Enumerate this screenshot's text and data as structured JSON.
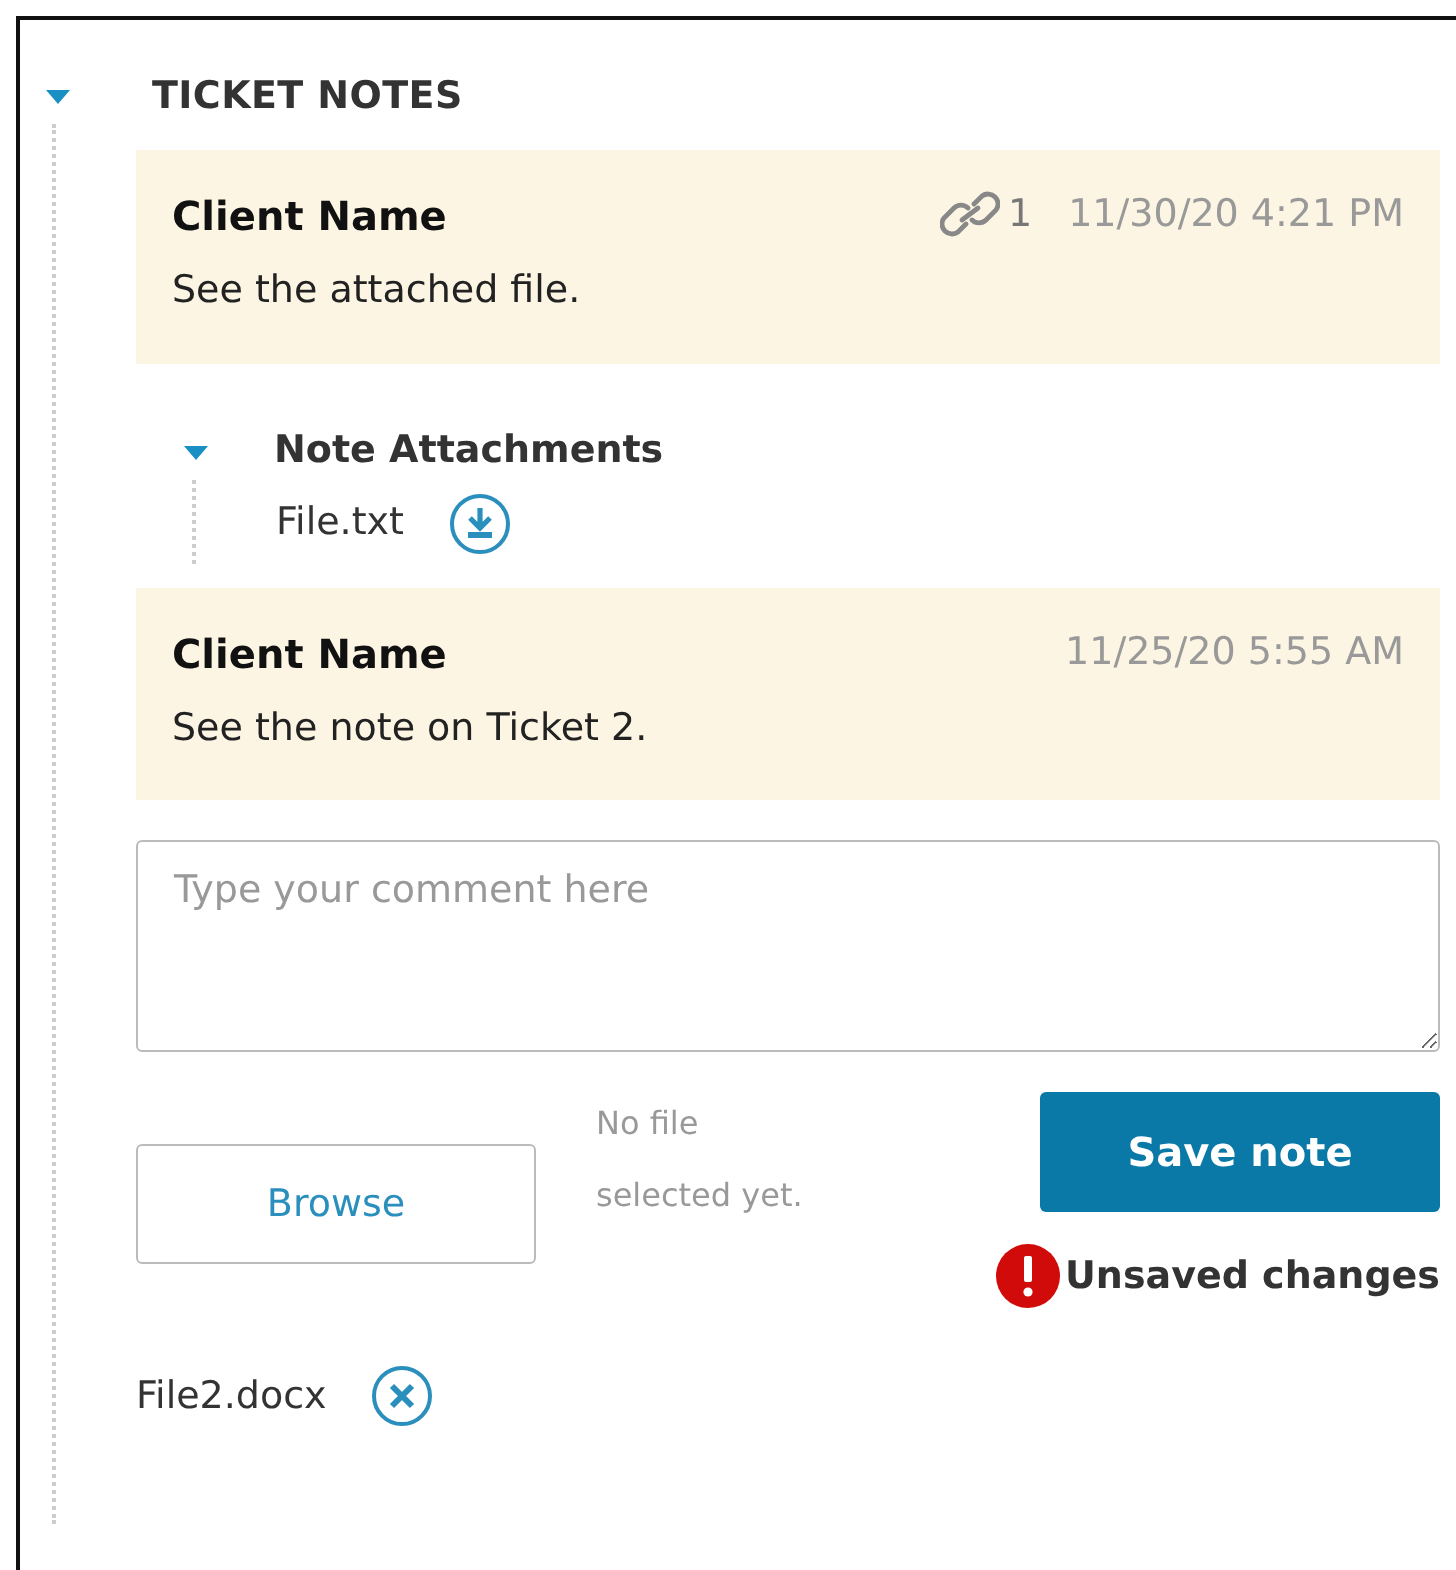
{
  "section": {
    "title": "TICKET NOTES",
    "expanded": true
  },
  "notes": [
    {
      "author": "Client Name",
      "attachment_count": "1",
      "time": "11/30/20 4:21 PM",
      "text": "See the attached file.",
      "attachments": {
        "label": "Note Attachments",
        "expanded": true,
        "files": [
          "File.txt"
        ]
      }
    },
    {
      "author": "Client Name",
      "time": "11/25/20 5:55 AM",
      "text": "See the note on Ticket 2."
    }
  ],
  "comment": {
    "placeholder": "Type your comment here"
  },
  "browse_button": "Browse",
  "file_status": "No file selected yet.",
  "save_button": "Save note",
  "warning": "Unsaved changes",
  "pending_files": [
    "File2.docx"
  ]
}
